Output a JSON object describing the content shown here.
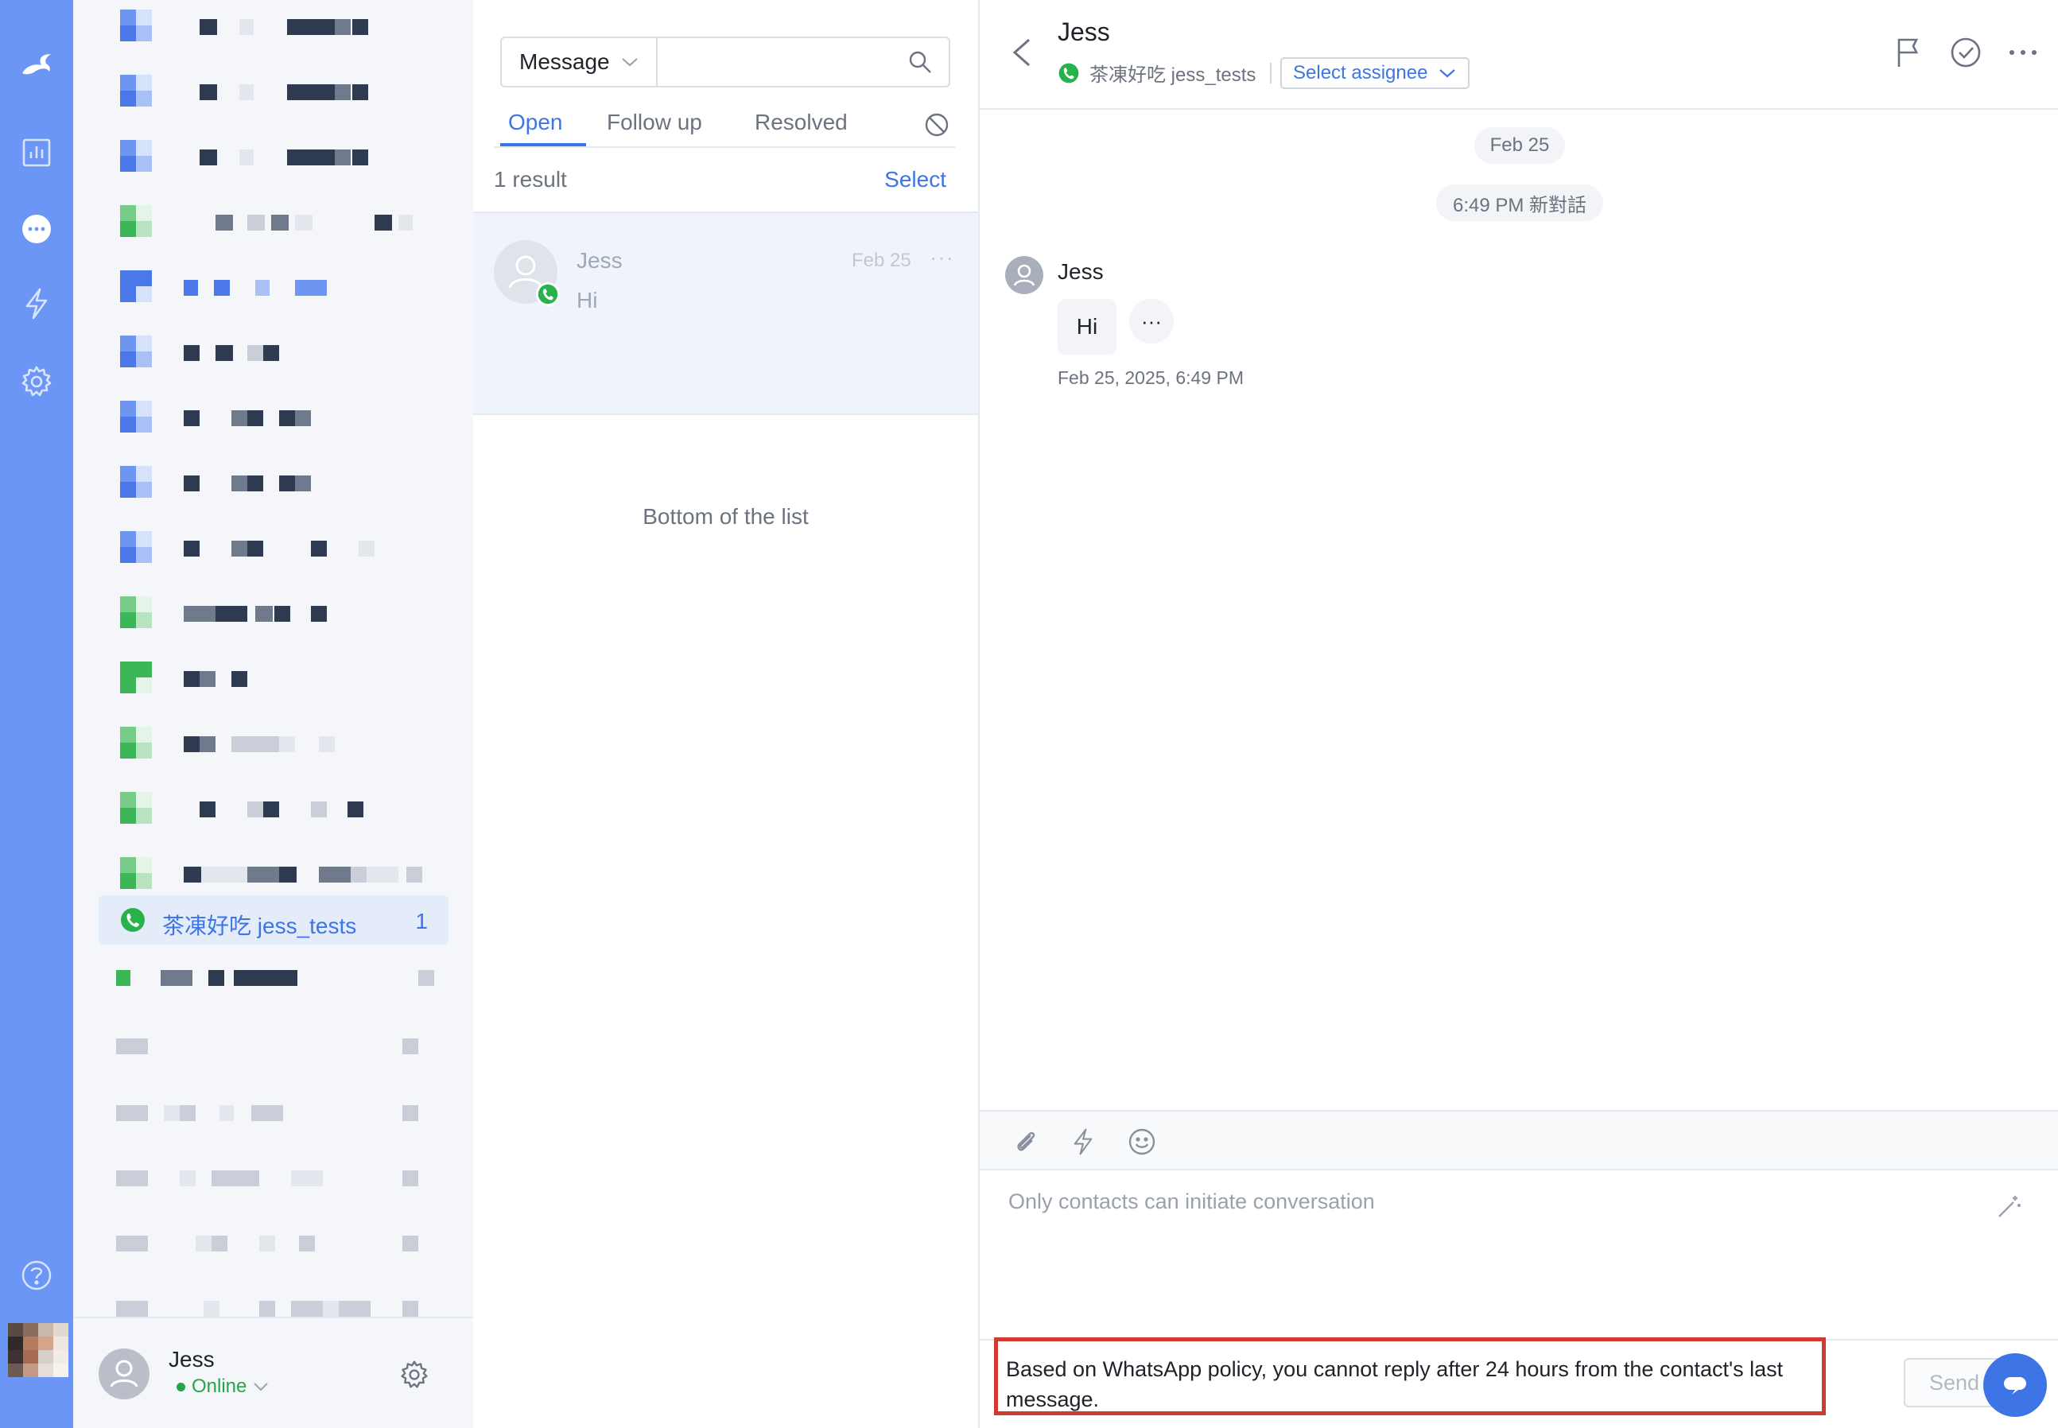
{
  "colors": {
    "rail": "#6c96f5",
    "accent": "#3e75e6",
    "whatsapp": "#27b24c",
    "warning_border": "#d13a30",
    "online": "#27a44b"
  },
  "rail": {
    "icons": [
      "brand-logo-icon",
      "analytics-icon",
      "chat-icon",
      "automation-bolt-icon",
      "settings-gear-icon",
      "help-icon"
    ]
  },
  "channels": {
    "active": {
      "name": "茶凍好吃 jess_tests",
      "count": "1",
      "icon": "whatsapp-icon"
    }
  },
  "me": {
    "name": "Jess",
    "status": "Online"
  },
  "list": {
    "search": {
      "type_label": "Message",
      "placeholder": ""
    },
    "tabs": [
      {
        "label": "Open"
      },
      {
        "label": "Follow up"
      },
      {
        "label": "Resolved"
      }
    ],
    "result_count": "1 result",
    "select_label": "Select",
    "conversation": {
      "name": "Jess",
      "preview": "Hi",
      "date": "Feb 25",
      "more": "···"
    },
    "bottom_note": "Bottom of the list"
  },
  "chat": {
    "contact_name": "Jess",
    "channel_name": "茶凍好吃 jess_tests",
    "assignee_label": "Select assignee",
    "date_pill": "Feb 25",
    "event_pill": "6:49 PM 新對話",
    "message": {
      "sender": "Jess",
      "text": "Hi",
      "more": "···",
      "timestamp": "Feb 25, 2025, 6:49 PM"
    },
    "composer": {
      "placeholder": "Only contacts can initiate conversation",
      "send_label": "Send",
      "warning": "Based on WhatsApp policy, you cannot reply after 24 hours from the contact's last message."
    }
  }
}
